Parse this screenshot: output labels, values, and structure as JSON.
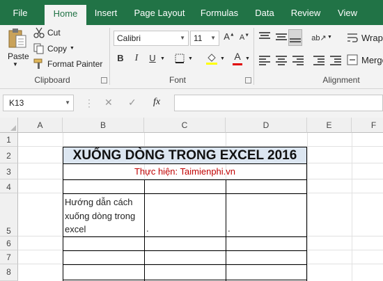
{
  "tabs": [
    "File",
    "Home",
    "Insert",
    "Page Layout",
    "Formulas",
    "Data",
    "Review",
    "View"
  ],
  "clipboard": {
    "paste": "Paste",
    "cut": "Cut",
    "copy": "Copy",
    "format_painter": "Format Painter",
    "label": "Clipboard"
  },
  "font": {
    "name": "Calibri",
    "size": "11",
    "bold": "B",
    "italic": "I",
    "underline": "U",
    "label": "Font"
  },
  "alignment": {
    "wrap": "Wrap",
    "merge": "Merge",
    "label": "Alignment"
  },
  "formula_bar": {
    "name_box": "K13",
    "fx": "fx",
    "formula": ""
  },
  "columns": [
    "A",
    "B",
    "C",
    "D",
    "E",
    "F"
  ],
  "rows": [
    "1",
    "2",
    "3",
    "4",
    "5",
    "6",
    "7",
    "8"
  ],
  "cells": {
    "B2_title": "XUỐNG DÒNG TRONG EXCEL 2016",
    "B3_subtitle": "Thực hiện: Taimienphi.vn",
    "B5_line1": "Hướng dẫn cách",
    "B5_line2": "xuống dòng trong",
    "B5_line3": "excel",
    "C5": ".",
    "D5": "."
  },
  "colors": {
    "brand": "#217346",
    "title_fill": "#dce6f1",
    "subtitle_text": "#c00000",
    "font_color_bar": "#e00000"
  }
}
